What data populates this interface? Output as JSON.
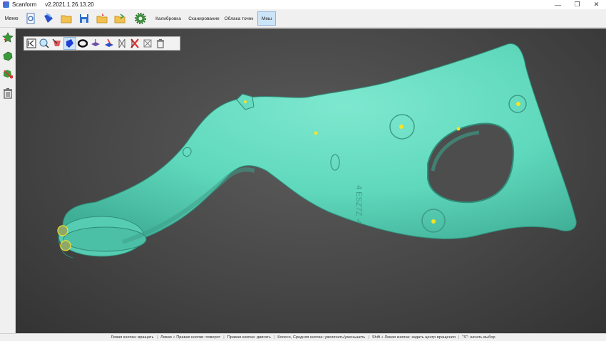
{
  "window": {
    "app_name": "Scanform",
    "version": "v2.2021.1.26.13.20",
    "minimize": "—",
    "maximize": "❐",
    "close": "✕"
  },
  "toolbar": {
    "menu_label": "Меню",
    "icons": [
      "new-project-icon",
      "import-icon",
      "open-folder-icon",
      "save-icon",
      "open-project-icon",
      "export-icon",
      "settings-icon"
    ],
    "tabs": [
      {
        "label": "Калибровка",
        "active": false
      },
      {
        "label": "Сканирование",
        "active": false
      },
      {
        "label": "Облака точек",
        "active": false
      },
      {
        "label": "Меш",
        "active": true
      }
    ]
  },
  "left_panel": {
    "icons": [
      "mesh-add-icon",
      "mesh-green-icon",
      "mesh-edit-icon",
      "trash-icon"
    ]
  },
  "mesh_tools": {
    "icons": [
      "collapse-panel-icon",
      "view-fit-icon",
      "select-points-icon",
      "fill-holes-icon",
      "ring-icon",
      "flip-normals-icon",
      "plane-cut-icon",
      "remove-spikes-icon",
      "delete-selected-icon",
      "decimate-icon",
      "trash-icon"
    ],
    "selected_index": 3
  },
  "part": {
    "engraving": "4 ESZ7Z ✓"
  },
  "colors": {
    "mesh": "#5fd8bc",
    "viewport": "#474747",
    "markers": "#f6e327",
    "active_tab": "#cce4f7"
  },
  "status_bar": {
    "hints": [
      "Левая кнопка: вращать",
      "Левая + Правая кнопки: поворот",
      "Правая кнопка: двигать",
      "Колесо, Средняя кнопка: увеличить/уменьшить",
      "Shift + Левая кнопка: задать центр вращения",
      "\"S\": начать выбор"
    ]
  }
}
